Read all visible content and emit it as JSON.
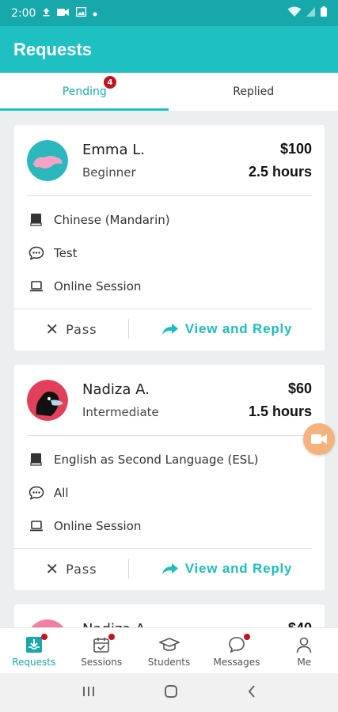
{
  "status_bar": {
    "time": "2:00"
  },
  "app_bar": {
    "title": "Requests"
  },
  "tabs": [
    {
      "label": "Pending",
      "badge": "4",
      "active": true
    },
    {
      "label": "Replied",
      "active": false
    }
  ],
  "requests": [
    {
      "name": "Emma L.",
      "level": "Beginner",
      "price": "$100",
      "duration": "2.5 hours",
      "subject": "Chinese (Mandarin)",
      "message": "Test",
      "session_type": "Online Session",
      "pass_label": "Pass",
      "reply_label": "View and Reply",
      "avatar_color": "#2bb8bd"
    },
    {
      "name": "Nadiza A.",
      "level": "Intermediate",
      "price": "$60",
      "duration": "1.5 hours",
      "subject": "English as Second Language (ESL)",
      "message": "All",
      "session_type": "Online Session",
      "pass_label": "Pass",
      "reply_label": "View and Reply",
      "avatar_color": "#e2405a"
    },
    {
      "name": "Nadiza A.",
      "price": "$40",
      "avatar_color": "#f07fa0"
    }
  ],
  "bottom_nav": [
    {
      "label": "Requests",
      "icon": "requests-icon",
      "active": true,
      "dot": true
    },
    {
      "label": "Sessions",
      "icon": "calendar-icon",
      "active": false,
      "dot": true
    },
    {
      "label": "Students",
      "icon": "graduation-cap-icon",
      "active": false,
      "dot": false
    },
    {
      "label": "Messages",
      "icon": "chat-bubble-icon",
      "active": false,
      "dot": true
    },
    {
      "label": "Me",
      "icon": "person-icon",
      "active": false,
      "dot": false
    }
  ],
  "colors": {
    "primary": "#1fc0c2",
    "status_bar": "#17a8ab",
    "badge": "#c1121f",
    "float_button": "#f6b27c"
  }
}
